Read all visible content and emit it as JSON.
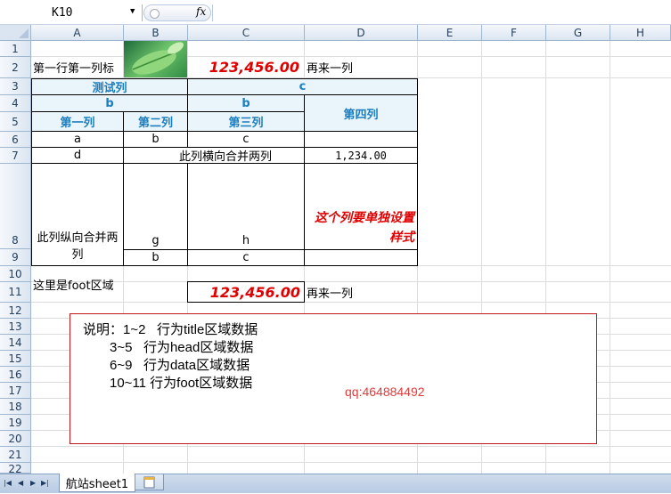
{
  "formula_bar": {
    "cell_ref": "K10",
    "fx_label": "fx",
    "formula": ""
  },
  "columns": [
    "A",
    "B",
    "C",
    "D",
    "E",
    "F",
    "G",
    "H"
  ],
  "rows": [
    "1",
    "2",
    "3",
    "4",
    "5",
    "6",
    "7",
    "8",
    "9",
    "10",
    "11",
    "12",
    "13",
    "14",
    "15",
    "16",
    "17",
    "18",
    "19",
    "20",
    "21",
    "22"
  ],
  "title_area": {
    "a2": "第一行第一列标",
    "c2": "123,456.00",
    "d2": "再来一列"
  },
  "head_area": {
    "a3": "测试列",
    "c3": "c",
    "a4": "b",
    "c4": "b",
    "a5": "第一列",
    "b5": "第二列",
    "c5": "第三列",
    "d4": "第四列"
  },
  "data_area": {
    "a6": "a",
    "b6": "b",
    "c6": "c",
    "a7": "d",
    "b7": "此列横向合并两列",
    "d7": "1,234.00",
    "a8": "此列纵向合并两列",
    "b8": "g",
    "c8": "h",
    "d8": "这个列要单独设置样式",
    "b9": "b",
    "c9": "c"
  },
  "foot_area": {
    "a10": "这里是foot区域",
    "c11": "123,456.00",
    "d11": "再来一列"
  },
  "notes": {
    "line1": "说明：1~2   行为title区域数据",
    "line2": "3~5   行为head区域数据",
    "line3": "6~9   行为data区域数据",
    "line4": "10~11 行为foot区域数据",
    "qq": "qq:464884492"
  },
  "sheet_tabs": {
    "active": "航站sheet1"
  },
  "colors": {
    "header_text": "#1a7ec0",
    "header_fill": "#eaf4fb",
    "accent_red": "#e00000",
    "note_border": "#c0191b"
  }
}
